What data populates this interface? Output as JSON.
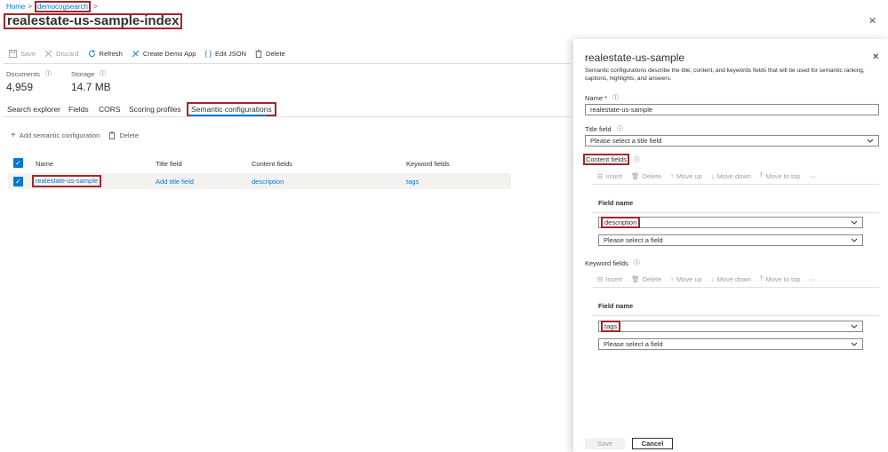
{
  "breadcrumb": {
    "home": "Home",
    "service": "democogsearch"
  },
  "page": {
    "title": "realestate-us-sample-index",
    "more": "···"
  },
  "toolbar": {
    "save": "Save",
    "discard": "Discard",
    "refresh": "Refresh",
    "create_demo_app": "Create Demo App",
    "edit_json": "Edit JSON",
    "delete": "Delete"
  },
  "stats": {
    "documents_label": "Documents",
    "documents_value": "4,959",
    "storage_label": "Storage",
    "storage_value": "14.7 MB"
  },
  "tabs": [
    {
      "label": "Search explorer"
    },
    {
      "label": "Fields"
    },
    {
      "label": "CORS"
    },
    {
      "label": "Scoring profiles"
    },
    {
      "label": "Semantic configurations"
    }
  ],
  "sem_toolbar": {
    "add": "Add semantic configuration",
    "delete": "Delete"
  },
  "table": {
    "headers": [
      "Name",
      "Title field",
      "Content fields",
      "Keyword fields"
    ],
    "rows": [
      {
        "name": "realestate-us-sample",
        "title_field": "Add title field",
        "content_fields": "description",
        "keyword_fields": "tags"
      }
    ]
  },
  "panel": {
    "title": "realestate-us-sample",
    "description": "Semantic configurations describe the title, content, and keywords fields that will be used for semantic ranking, captions, highlights, and answers.",
    "name_label": "Name *",
    "name_value": "realestate-us-sample",
    "title_field_label": "Title field",
    "title_field_placeholder": "Please select a title field",
    "content_fields_label": "Content fields",
    "keyword_fields_label": "Keyword fields",
    "grid_toolbar": {
      "insert": "Insert",
      "delete": "Delete",
      "move_up": "Move up",
      "move_down": "Move down",
      "move_to_top": "Move to top",
      "more": "···"
    },
    "field_name_header": "Field name",
    "content_field_value": "description",
    "keyword_field_value": "tags",
    "select_field_placeholder": "Please select a field",
    "save": "Save",
    "cancel": "Cancel"
  },
  "colors": {
    "accent": "#0078d4",
    "highlight": "#a4262c",
    "row_selected": "#f3f2f1"
  }
}
